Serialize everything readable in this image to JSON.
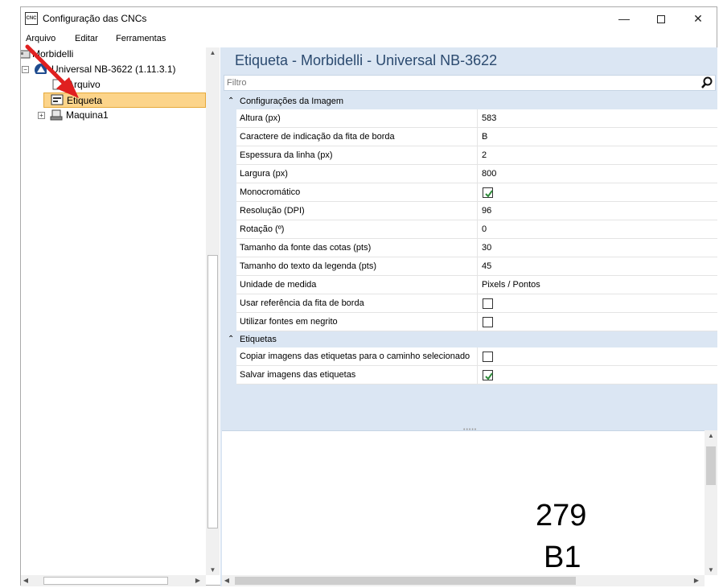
{
  "window": {
    "title": "Configuração das CNCs",
    "icon_text": "CNC",
    "controls": {
      "minimize": "—",
      "close": "✕"
    }
  },
  "menu": [
    "Arquivo",
    "Editar",
    "Ferramentas"
  ],
  "tree": {
    "items": [
      {
        "label": "Morbidelli",
        "level": 0
      },
      {
        "label": "Universal NB-3622 (1.11.3.1)",
        "level": 1,
        "expanded": true
      },
      {
        "label": "Arquivo",
        "level": 2
      },
      {
        "label": "Etiqueta",
        "level": 2,
        "selected": true
      },
      {
        "label": "Maquina1",
        "level": 2,
        "expanded": false
      }
    ]
  },
  "panel": {
    "title": "Etiqueta - Morbidelli - Universal NB-3622",
    "filter_placeholder": "Filtro"
  },
  "categories": [
    {
      "name": "Configurações da Imagem",
      "properties": [
        {
          "name": "Altura (px)",
          "value": "583"
        },
        {
          "name": "Caractere de indicação da fita de borda",
          "value": "B"
        },
        {
          "name": "Espessura da linha (px)",
          "value": "2"
        },
        {
          "name": "Largura (px)",
          "value": "800"
        },
        {
          "name": "Monocromático",
          "checkbox": true,
          "checked": true
        },
        {
          "name": "Resolução (DPI)",
          "value": "96"
        },
        {
          "name": "Rotação (º)",
          "value": "0"
        },
        {
          "name": "Tamanho da fonte das cotas (pts)",
          "value": "30"
        },
        {
          "name": "Tamanho do texto da legenda (pts)",
          "value": "45"
        },
        {
          "name": "Unidade de medida",
          "value": "Pixels / Pontos"
        },
        {
          "name": "Usar referência da fita de borda",
          "checkbox": true,
          "checked": false
        },
        {
          "name": "Utilizar fontes em negrito",
          "checkbox": true,
          "checked": false
        }
      ]
    },
    {
      "name": "Etiquetas",
      "properties": [
        {
          "name": "Copiar imagens das etiquetas para o caminho selecionado",
          "checkbox": true,
          "checked": false
        },
        {
          "name": "Salvar imagens das etiquetas",
          "checkbox": true,
          "checked": true
        }
      ]
    }
  ],
  "preview": {
    "dimension": "279",
    "edge_code": "B1"
  },
  "colors": {
    "accent": "#2b4a6f",
    "selection": "#fcd48a",
    "panel_bg": "#dbe6f3",
    "annotation_arrow": "#e02020"
  }
}
